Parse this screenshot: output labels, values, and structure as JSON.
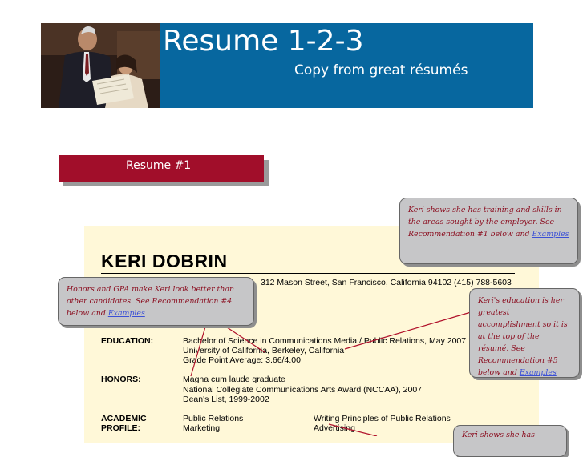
{
  "header": {
    "title": "Resume 1-2-3",
    "subtitle": "Copy from great résumés"
  },
  "tab": {
    "label": "Resume  #1"
  },
  "resume": {
    "name": "KERI DOBRIN",
    "address": "312 Mason Street, San Francisco, California  94102  (415) 788-5603",
    "education_label": "EDUCATION:",
    "education_lines": [
      "Bachelor of Science in Communications Media / Public Relations, May 2007",
      "University of California, Berkeley, California",
      "Grade Point Average:  3.66/4.00"
    ],
    "honors_label": "HONORS:",
    "honors_lines": [
      "Magna cum laude graduate",
      "National Collegiate Communications Arts Award (NCCAA), 2007",
      "Dean's List, 1999-2002"
    ],
    "academic_label_1": "ACADEMIC",
    "academic_label_2": "PROFILE:",
    "academic_col1": [
      "Public Relations",
      "Marketing"
    ],
    "academic_col2": [
      "Writing Principles of Public Relations",
      "Advertising"
    ]
  },
  "callouts": {
    "top_right": {
      "text": "Keri shows she has training and skills in the  areas sought by the employer.  See Recommendation #1 below and",
      "link": "Examples"
    },
    "left": {
      "text": "Honors and GPA make Keri look better than other candidates.  See Recommendation #4 below and",
      "link": "Examples"
    },
    "mid_right": {
      "text": "Keri's education is her greatest accomplishment so it is at the top of the résumé.  See Recommendation #5 below and",
      "link": "Examples"
    },
    "bottom_right": {
      "text": "Keri shows she has"
    }
  },
  "colors": {
    "banner": "#07679f",
    "tab": "#a10e2a",
    "paper": "#fff8d8",
    "callout_text": "#8b0d1f",
    "callout_bg": "#c6c6c8",
    "link": "#3b50d6"
  }
}
